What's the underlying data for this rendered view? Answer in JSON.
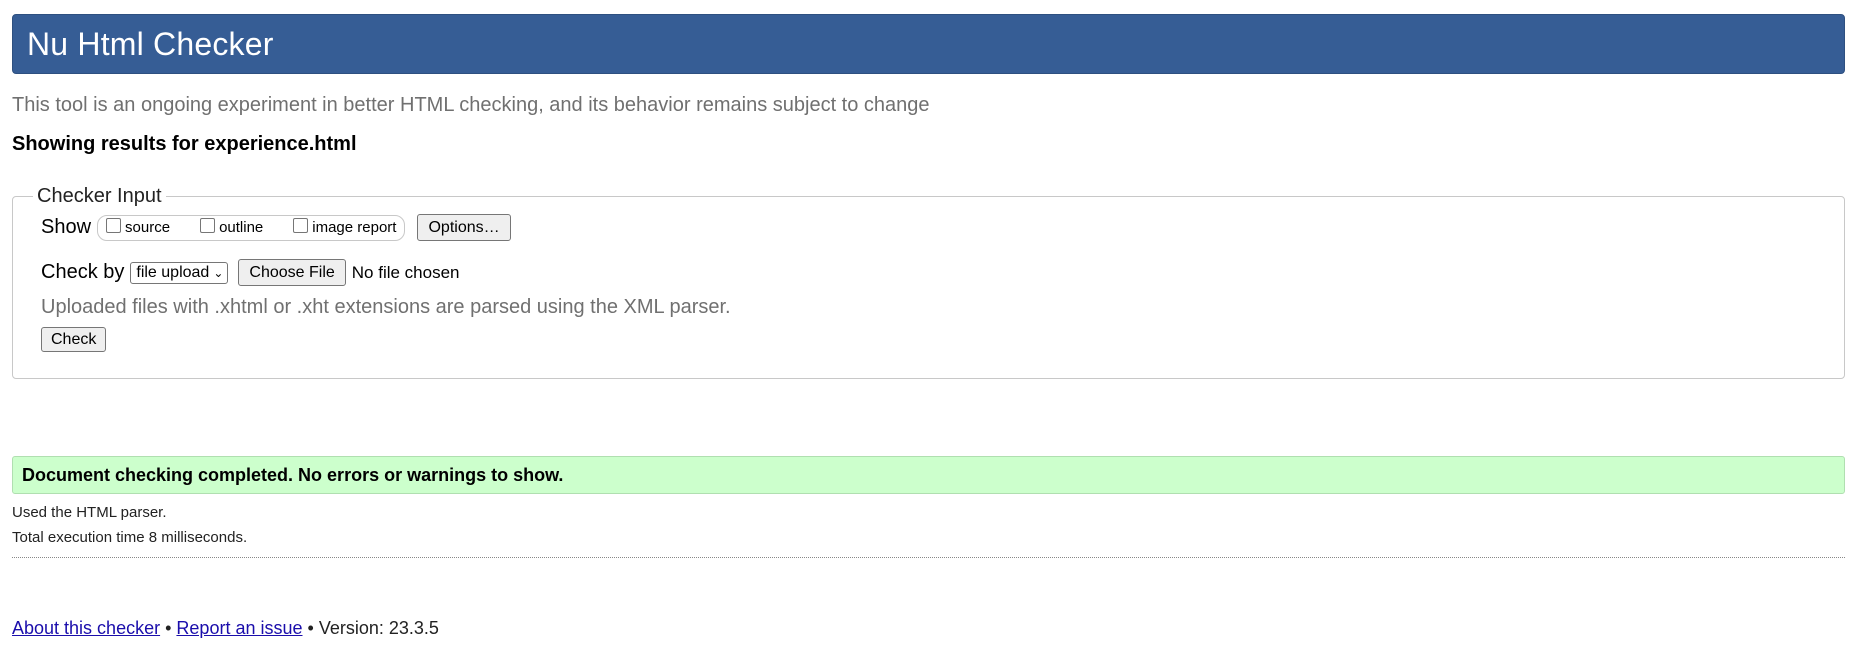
{
  "header": {
    "title": "Nu Html Checker"
  },
  "subtitle": "This tool is an ongoing experiment in better HTML checking, and its behavior remains subject to change",
  "results_for": "Showing results for experience.html",
  "checker_input": {
    "legend": "Checker Input",
    "show_label": "Show",
    "show_options": [
      "source",
      "outline",
      "image report"
    ],
    "options_button": "Options…",
    "check_by_label": "Check by",
    "check_by_selected": "file upload",
    "choose_file_button": "Choose File",
    "file_status": "No file chosen",
    "parser_note": "Uploaded files with .xhtml or .xht extensions are parsed using the XML parser.",
    "check_button": "Check"
  },
  "result": {
    "message": "Document checking completed. No errors or warnings to show.",
    "parser_used": "Used the HTML parser.",
    "execution_time": "Total execution time 8 milliseconds.",
    "colors": {
      "success_bg": "#ccffcc",
      "banner_bg": "#365d95"
    }
  },
  "footer": {
    "about_link": "About this checker",
    "separator": "•",
    "report_link": "Report an issue",
    "version": "Version: 23.3.5"
  }
}
